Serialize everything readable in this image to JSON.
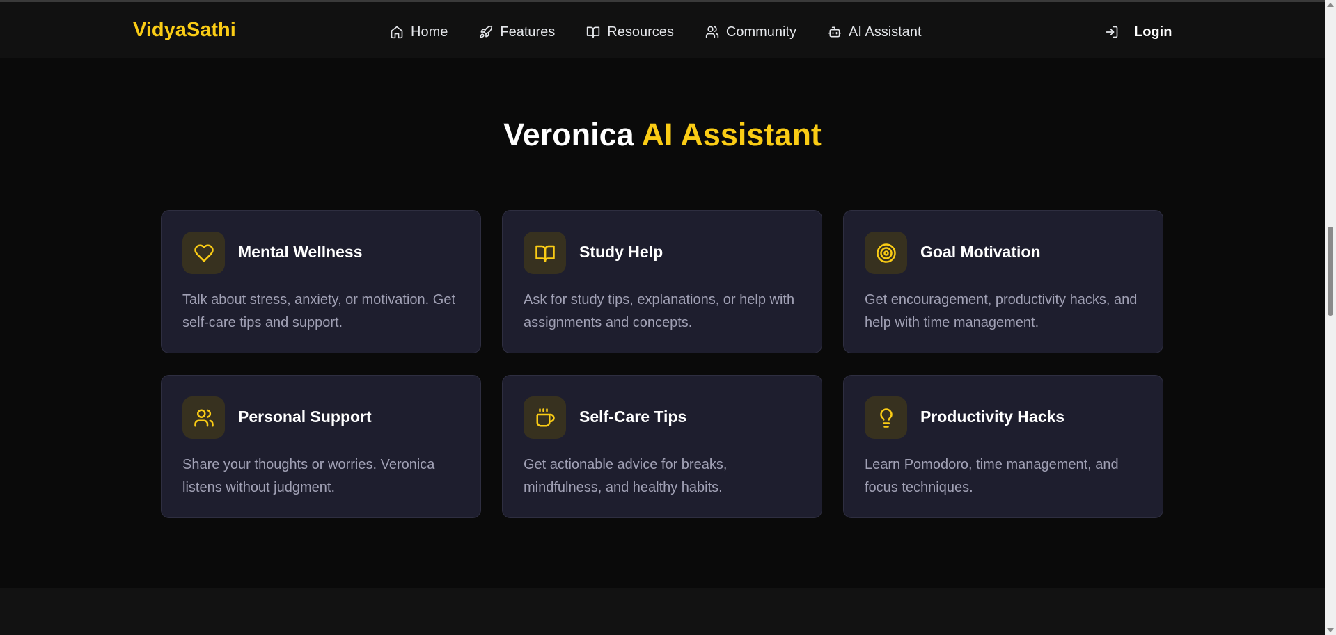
{
  "brand": "VidyaSathi",
  "nav": [
    {
      "label": "Home",
      "icon": "home-icon"
    },
    {
      "label": "Features",
      "icon": "rocket-icon"
    },
    {
      "label": "Resources",
      "icon": "book-icon"
    },
    {
      "label": "Community",
      "icon": "users-icon"
    },
    {
      "label": "AI Assistant",
      "icon": "bot-icon"
    }
  ],
  "login": {
    "label": "Login",
    "icon": "login-icon"
  },
  "section": {
    "title_main": "Veronica",
    "title_accent": "AI Assistant"
  },
  "cards": [
    {
      "title": "Mental Wellness",
      "icon": "heart-icon",
      "desc": "Talk about stress, anxiety, or motivation. Get self-care tips and support."
    },
    {
      "title": "Study Help",
      "icon": "book-open-icon",
      "desc": "Ask for study tips, explanations, or help with assignments and concepts."
    },
    {
      "title": "Goal Motivation",
      "icon": "target-icon",
      "desc": "Get encouragement, productivity hacks, and help with time management."
    },
    {
      "title": "Personal Support",
      "icon": "users-icon",
      "desc": "Share your thoughts or worries. Veronica listens without judgment."
    },
    {
      "title": "Self-Care Tips",
      "icon": "coffee-icon",
      "desc": "Get actionable advice for breaks, mindfulness, and healthy habits."
    },
    {
      "title": "Productivity Hacks",
      "icon": "lightbulb-icon",
      "desc": "Learn Pomodoro, time management, and focus techniques."
    }
  ],
  "colors": {
    "accent": "#facc15",
    "card_bg": "#1e1e2e",
    "bg": "#0a0a0a"
  }
}
